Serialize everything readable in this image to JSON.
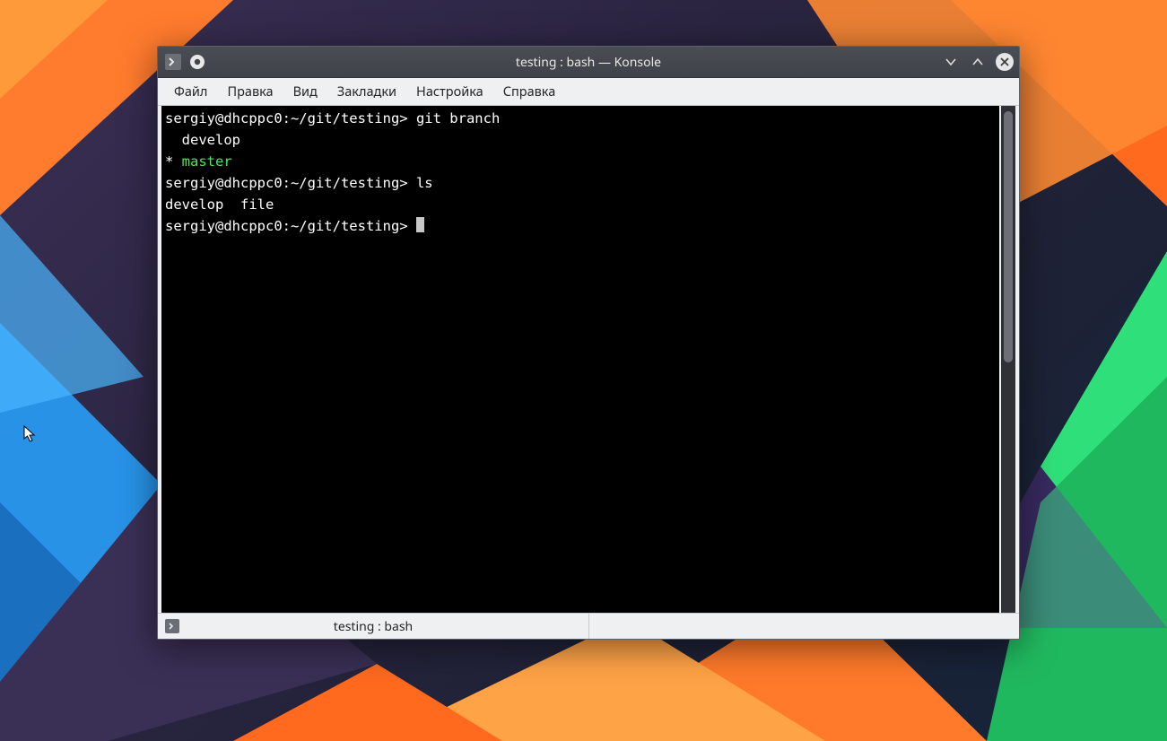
{
  "window": {
    "title": "testing : bash — Konsole"
  },
  "menubar": {
    "items": [
      "Файл",
      "Правка",
      "Вид",
      "Закладки",
      "Настройка",
      "Справка"
    ]
  },
  "terminal": {
    "lines": [
      {
        "segments": [
          {
            "text": "sergiy@dhcppc0:~/git/testing> git branch"
          }
        ]
      },
      {
        "segments": [
          {
            "text": "  develop"
          }
        ]
      },
      {
        "segments": [
          {
            "text": "* "
          },
          {
            "text": "master",
            "class": "green"
          }
        ]
      },
      {
        "segments": [
          {
            "text": "sergiy@dhcppc0:~/git/testing> ls"
          }
        ]
      },
      {
        "segments": [
          {
            "text": "develop  file"
          }
        ]
      },
      {
        "segments": [
          {
            "text": "sergiy@dhcppc0:~/git/testing> "
          },
          {
            "cursor": true
          }
        ]
      }
    ]
  },
  "tab": {
    "label": "testing : bash"
  }
}
